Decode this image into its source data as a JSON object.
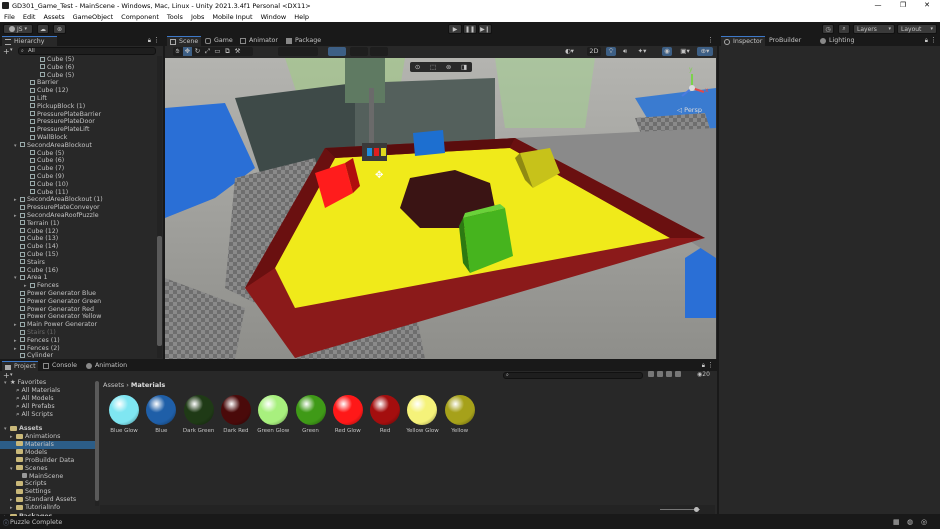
{
  "window": {
    "title": "GD301_Game_Test - MainScene - Windows, Mac, Linux - Unity 2021.3.4f1 Personal <DX11>",
    "minimize": "—",
    "maximize": "❐",
    "close": "✕"
  },
  "menu": [
    "File",
    "Edit",
    "Assets",
    "GameObject",
    "Component",
    "Tools",
    "Jobs",
    "Mobile Input",
    "Window",
    "Help"
  ],
  "toolbar": {
    "account": "JS",
    "layers": "Layers",
    "layout": "Layout"
  },
  "hierarchy": {
    "tab": "Hierarchy",
    "search": "All",
    "rows": [
      {
        "label": "Cube (5)",
        "indent": 3,
        "dim": false,
        "arrow": ""
      },
      {
        "label": "Cube (6)",
        "indent": 3,
        "dim": false,
        "arrow": ""
      },
      {
        "label": "Cube (5)",
        "indent": 3,
        "dim": false,
        "arrow": ""
      },
      {
        "label": "Barrier",
        "indent": 2,
        "dim": false,
        "arrow": ""
      },
      {
        "label": "Cube (12)",
        "indent": 2,
        "dim": false,
        "arrow": ""
      },
      {
        "label": "Lift",
        "indent": 2,
        "dim": false,
        "arrow": ""
      },
      {
        "label": "PickupBlock (1)",
        "indent": 2,
        "dim": false,
        "arrow": ""
      },
      {
        "label": "PressurePlateBarrier",
        "indent": 2,
        "dim": false,
        "arrow": ""
      },
      {
        "label": "PressurePlateDoor",
        "indent": 2,
        "dim": false,
        "arrow": ""
      },
      {
        "label": "PressurePlateLift",
        "indent": 2,
        "dim": false,
        "arrow": ""
      },
      {
        "label": "WallBlock",
        "indent": 2,
        "dim": false,
        "arrow": ""
      },
      {
        "label": "SecondAreaBlockout",
        "indent": 1,
        "dim": false,
        "arrow": "▾"
      },
      {
        "label": "Cube (5)",
        "indent": 2,
        "dim": false,
        "arrow": ""
      },
      {
        "label": "Cube (6)",
        "indent": 2,
        "dim": false,
        "arrow": ""
      },
      {
        "label": "Cube (7)",
        "indent": 2,
        "dim": false,
        "arrow": ""
      },
      {
        "label": "Cube (9)",
        "indent": 2,
        "dim": false,
        "arrow": ""
      },
      {
        "label": "Cube (10)",
        "indent": 2,
        "dim": false,
        "arrow": ""
      },
      {
        "label": "Cube (11)",
        "indent": 2,
        "dim": false,
        "arrow": ""
      },
      {
        "label": "SecondAreaBlockout (1)",
        "indent": 1,
        "dim": false,
        "arrow": "▸"
      },
      {
        "label": "PressurePlateConveyor",
        "indent": 1,
        "dim": false,
        "arrow": ""
      },
      {
        "label": "SecondAreaRoofPuzzle",
        "indent": 1,
        "dim": false,
        "arrow": "▸"
      },
      {
        "label": "Terrain (1)",
        "indent": 1,
        "dim": false,
        "arrow": ""
      },
      {
        "label": "Cube (12)",
        "indent": 1,
        "dim": false,
        "arrow": ""
      },
      {
        "label": "Cube (13)",
        "indent": 1,
        "dim": false,
        "arrow": ""
      },
      {
        "label": "Cube (14)",
        "indent": 1,
        "dim": false,
        "arrow": ""
      },
      {
        "label": "Cube (15)",
        "indent": 1,
        "dim": false,
        "arrow": ""
      },
      {
        "label": "Stairs",
        "indent": 1,
        "dim": false,
        "arrow": ""
      },
      {
        "label": "Cube (16)",
        "indent": 1,
        "dim": false,
        "arrow": ""
      },
      {
        "label": "Area 1",
        "indent": 1,
        "dim": false,
        "arrow": "▾"
      },
      {
        "label": "Fences",
        "indent": 2,
        "dim": false,
        "arrow": "▸"
      },
      {
        "label": "Power Generator Blue",
        "indent": 1,
        "dim": false,
        "arrow": ""
      },
      {
        "label": "Power Generator Green",
        "indent": 1,
        "dim": false,
        "arrow": ""
      },
      {
        "label": "Power Generator Red",
        "indent": 1,
        "dim": false,
        "arrow": ""
      },
      {
        "label": "Power Generator Yellow",
        "indent": 1,
        "dim": false,
        "arrow": ""
      },
      {
        "label": "Main Power Generator",
        "indent": 1,
        "dim": false,
        "arrow": "▸"
      },
      {
        "label": "Stairs (1)",
        "indent": 1,
        "dim": true,
        "arrow": ""
      },
      {
        "label": "Fences (1)",
        "indent": 1,
        "dim": false,
        "arrow": "▸"
      },
      {
        "label": "Fences (2)",
        "indent": 1,
        "dim": false,
        "arrow": "▸"
      },
      {
        "label": "Cylinder",
        "indent": 1,
        "dim": false,
        "arrow": ""
      }
    ]
  },
  "scene_tabs": [
    {
      "label": "Scene",
      "active": true
    },
    {
      "label": "Game",
      "active": false
    },
    {
      "label": "Animator",
      "active": false
    },
    {
      "label": "Package Manager",
      "active": false
    }
  ],
  "scene": {
    "mode_2d": "2D",
    "persp": "Persp",
    "gizmo_y": "y",
    "gizmo_x": "x"
  },
  "right_tabs": [
    {
      "label": "Inspector",
      "active": true
    },
    {
      "label": "ProBuilder",
      "active": false
    },
    {
      "label": "Lighting",
      "active": false
    }
  ],
  "bottom_tabs": [
    {
      "label": "Project",
      "active": true
    },
    {
      "label": "Console",
      "active": false
    },
    {
      "label": "Animation",
      "active": false
    }
  ],
  "project_tree": {
    "favorites": "Favorites",
    "fav_items": [
      "All Materials",
      "All Models",
      "All Prefabs",
      "All Scripts"
    ],
    "assets": "Assets",
    "asset_items": [
      {
        "label": "Animations",
        "indent": 1,
        "arrow": "▸",
        "selected": false
      },
      {
        "label": "Materials",
        "indent": 1,
        "arrow": "",
        "selected": true
      },
      {
        "label": "Models",
        "indent": 1,
        "arrow": "",
        "selected": false
      },
      {
        "label": "ProBuilder Data",
        "indent": 1,
        "arrow": "",
        "selected": false
      },
      {
        "label": "Scenes",
        "indent": 1,
        "arrow": "▾",
        "selected": false
      },
      {
        "label": "MainScene",
        "indent": 2,
        "arrow": "",
        "selected": false
      },
      {
        "label": "Scripts",
        "indent": 1,
        "arrow": "",
        "selected": false
      },
      {
        "label": "Settings",
        "indent": 1,
        "arrow": "",
        "selected": false
      },
      {
        "label": "Standard Assets",
        "indent": 1,
        "arrow": "▸",
        "selected": false
      },
      {
        "label": "TutorialInfo",
        "indent": 1,
        "arrow": "▸",
        "selected": false
      }
    ],
    "packages": "Packages"
  },
  "breadcrumb": {
    "root": "Assets",
    "sep": "›",
    "current": "Materials"
  },
  "assets_count": "20",
  "materials": [
    {
      "label": "Blue Glow",
      "color": "#7fe6f2"
    },
    {
      "label": "Blue",
      "color": "#1f5fa8"
    },
    {
      "label": "Dark Green",
      "color": "#1f3a16"
    },
    {
      "label": "Dark Red",
      "color": "#4a0a0a"
    },
    {
      "label": "Green Glow",
      "color": "#a8f07e"
    },
    {
      "label": "Green",
      "color": "#3f9a17"
    },
    {
      "label": "Red Glow",
      "color": "#ff1818"
    },
    {
      "label": "Red",
      "color": "#a40e0e"
    },
    {
      "label": "Yellow Glow",
      "color": "#f5f27a"
    },
    {
      "label": "Yellow",
      "color": "#a6a11a"
    }
  ],
  "status": {
    "text": "Puzzle Complete"
  }
}
